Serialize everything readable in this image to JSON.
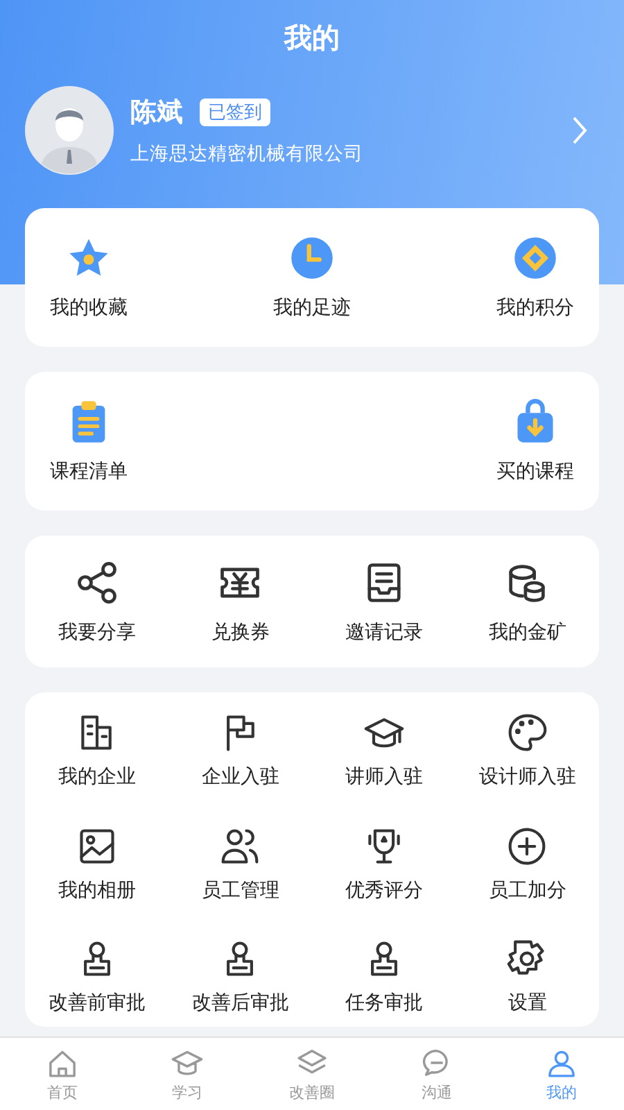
{
  "header": {
    "title": "我的"
  },
  "profile": {
    "name": "陈斌",
    "badge": "已签到",
    "company": "上海思达精密机械有限公司"
  },
  "favorites": [
    {
      "label": "我的收藏"
    },
    {
      "label": "我的足迹"
    },
    {
      "label": "我的积分"
    }
  ],
  "courses": [
    {
      "label": "课程清单"
    },
    {
      "label": "买的课程"
    }
  ],
  "share": [
    {
      "label": "我要分享"
    },
    {
      "label": "兑换券"
    },
    {
      "label": "邀请记录"
    },
    {
      "label": "我的金矿"
    }
  ],
  "tools": [
    {
      "label": "我的企业"
    },
    {
      "label": "企业入驻"
    },
    {
      "label": "讲师入驻"
    },
    {
      "label": "设计师入驻"
    },
    {
      "label": "我的相册"
    },
    {
      "label": "员工管理"
    },
    {
      "label": "优秀评分"
    },
    {
      "label": "员工加分"
    },
    {
      "label": "改善前审批"
    },
    {
      "label": "改善后审批"
    },
    {
      "label": "任务审批"
    },
    {
      "label": "设置"
    }
  ],
  "tab_bar": [
    {
      "label": "首页",
      "selected": false
    },
    {
      "label": "学习",
      "selected": false
    },
    {
      "label": "改善圈",
      "selected": false
    },
    {
      "label": "沟通",
      "selected": false
    },
    {
      "label": "我的",
      "selected": true
    }
  ]
}
